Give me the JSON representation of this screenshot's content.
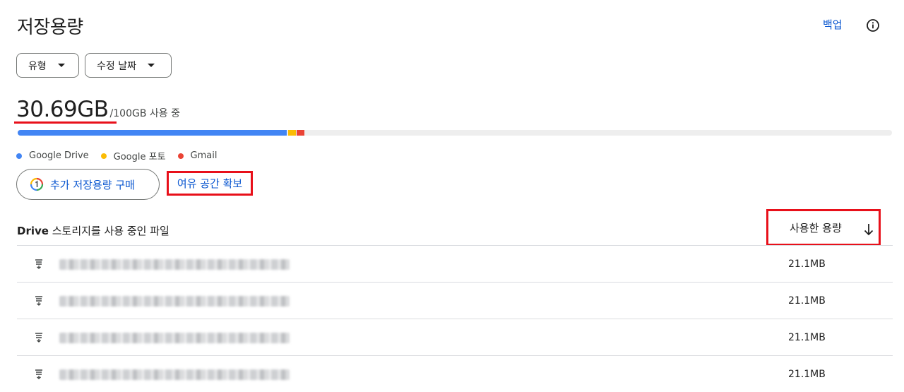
{
  "header": {
    "title": "저장용량",
    "backup_label": "백업"
  },
  "filters": {
    "type_label": "유형",
    "date_label": "수정 날짜"
  },
  "usage": {
    "used": "30.69GB",
    "total_text": "/100GB 사용 중"
  },
  "storage_breakdown": {
    "drive_fraction": 0.308,
    "photos_fraction": 0.009,
    "gmail_fraction": 0.009
  },
  "legend": [
    {
      "label": "Google Drive",
      "color": "#4285f4"
    },
    {
      "label": "Google 포토",
      "color": "#fbbc04"
    },
    {
      "label": "Gmail",
      "color": "#ea4335"
    }
  ],
  "actions": {
    "buy_storage_label": "추가 저장용량 구매",
    "free_space_label": "여유 공간 확보"
  },
  "files": {
    "title_bold": "Drive",
    "title_rest": " 스토리지를 사용 중인 파일",
    "sort_label": "사용한 용량",
    "rows": [
      {
        "size": "21.1MB"
      },
      {
        "size": "21.1MB"
      },
      {
        "size": "21.1MB"
      },
      {
        "size": "21.1MB"
      }
    ]
  },
  "colors": {
    "accent_blue": "#0b57d0",
    "highlight_red": "#e8101a"
  }
}
